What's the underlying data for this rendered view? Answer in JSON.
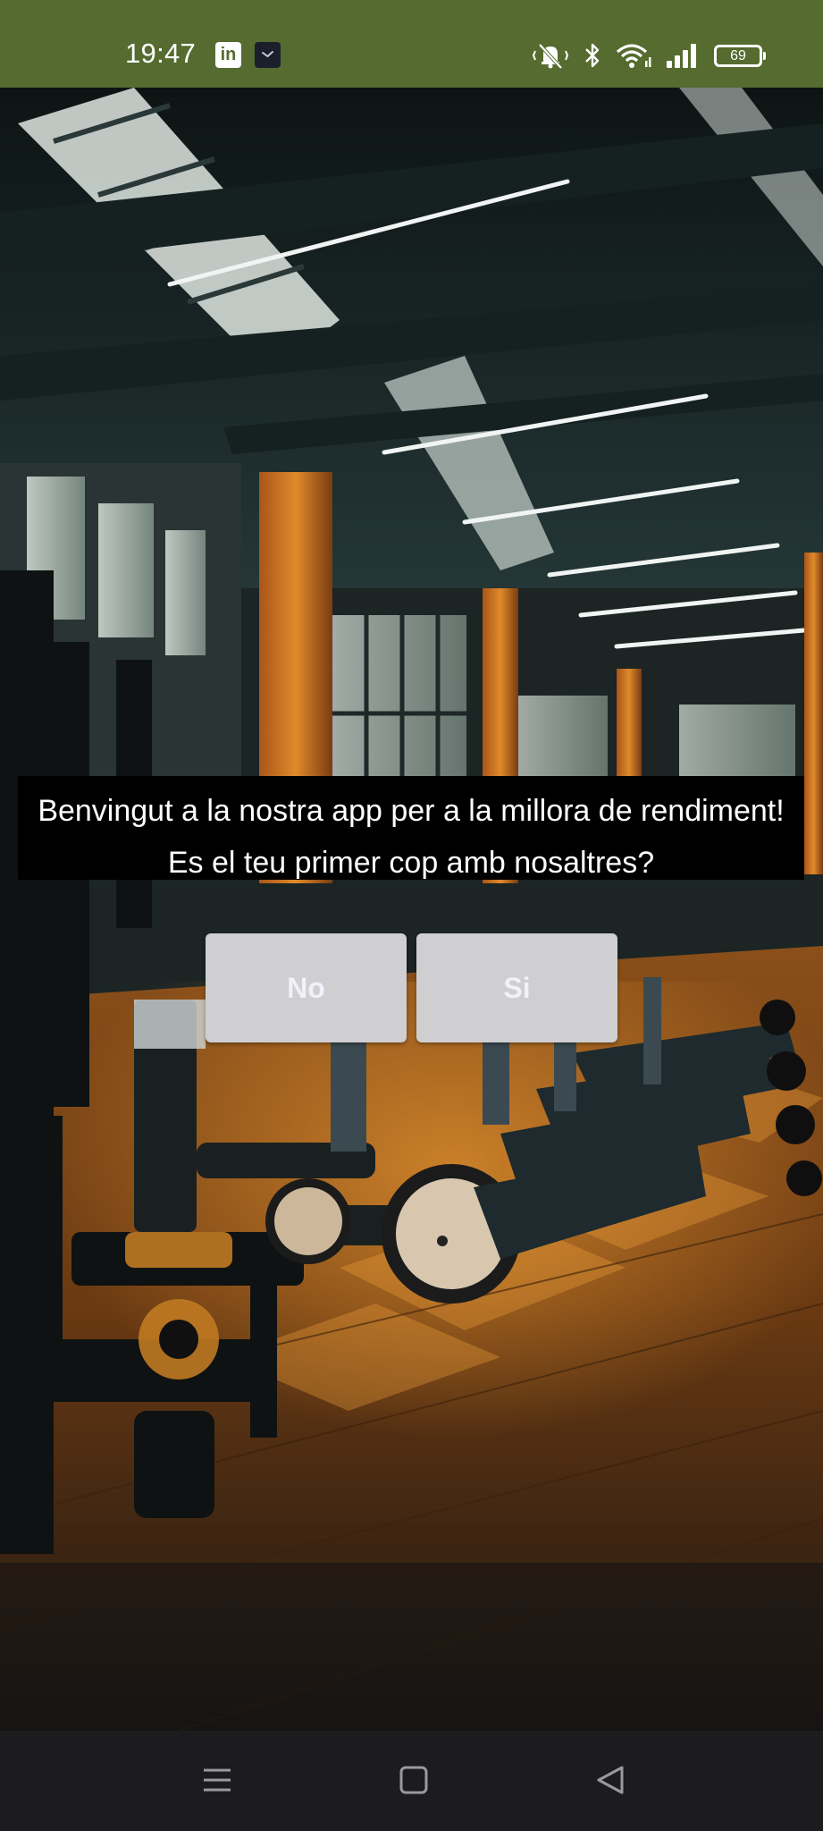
{
  "status_bar": {
    "time": "19:47",
    "notifications": [
      {
        "icon": "linkedin-icon",
        "glyph": "in"
      },
      {
        "icon": "clock-app-icon"
      }
    ],
    "battery_level": "69",
    "icons": [
      "mute-vibrate-icon",
      "bluetooth-icon",
      "wifi-icon",
      "signal-icon",
      "battery-icon"
    ]
  },
  "background": {
    "scene": "gym-interior",
    "colors": {
      "ceiling": "#1f2c2c",
      "floor": "#6b3a12",
      "accent": "#d47a1e"
    }
  },
  "welcome": {
    "line1": "Benvingut a la nostra app per a la millora de rendiment!",
    "line2": "Es el teu primer cop amb nosaltres?"
  },
  "buttons": {
    "no": "No",
    "si": "Si"
  },
  "nav_bar": {
    "items": [
      "menu-icon",
      "home-icon",
      "back-icon"
    ]
  },
  "colors": {
    "status_bar": "#556b2f",
    "button_bg": "#cfcfd1",
    "button_text": "#f2f0f8",
    "banner_bg": "#000000",
    "nav_bg": "#1c1c1e"
  }
}
